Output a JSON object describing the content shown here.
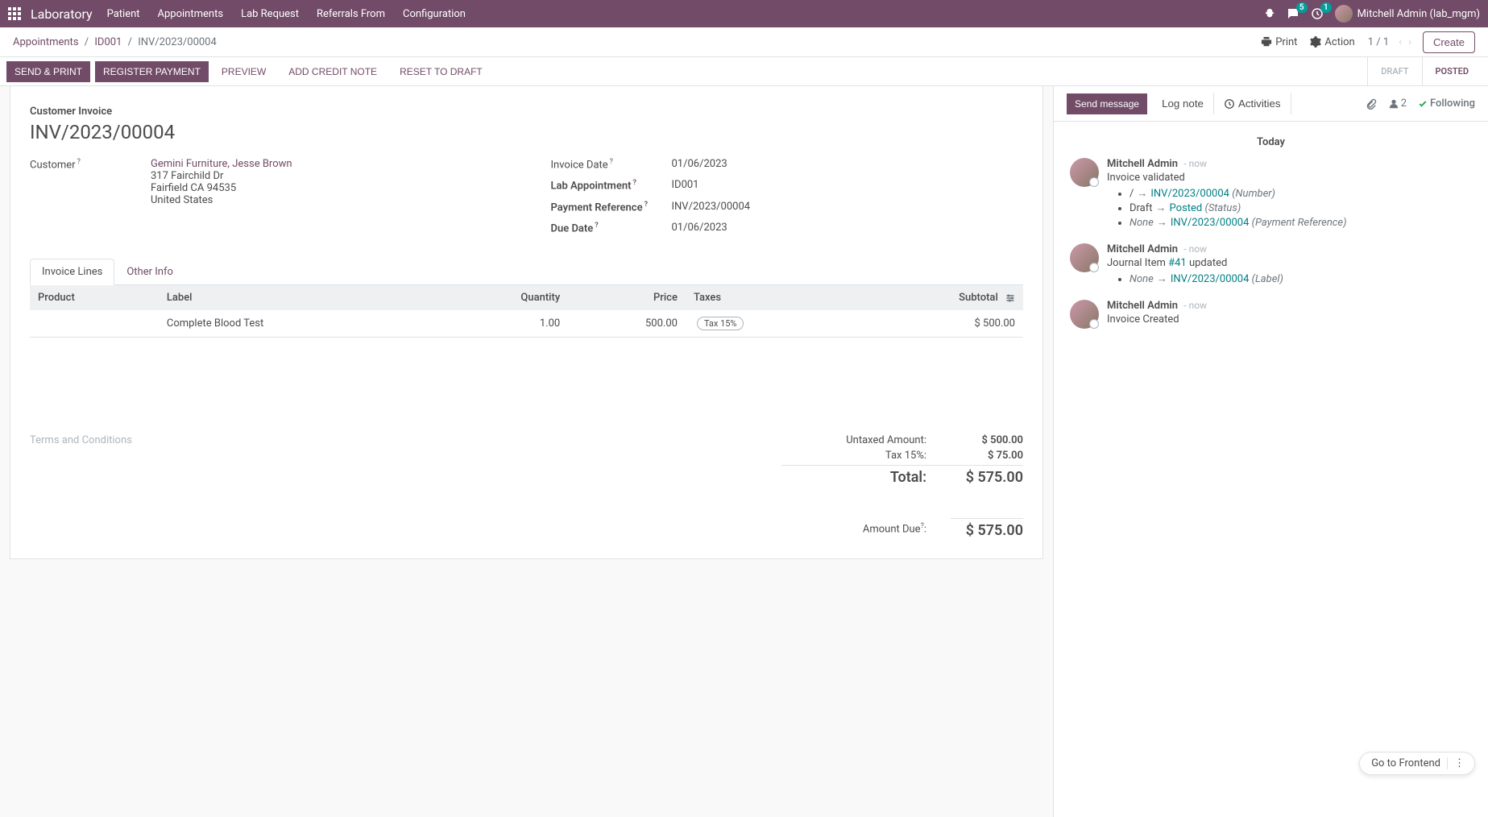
{
  "topnav": {
    "app": "Laboratory",
    "items": [
      "Patient",
      "Appointments",
      "Lab Request",
      "Referrals From",
      "Configuration"
    ],
    "msg_badge": "5",
    "clock_badge": "1",
    "user": "Mitchell Admin (lab_mgm)"
  },
  "breadcrumb": {
    "items": [
      "Appointments",
      "ID001"
    ],
    "current": "INV/2023/00004"
  },
  "controlbar": {
    "print": "Print",
    "action": "Action",
    "pager": "1 / 1",
    "create": "Create"
  },
  "statusbar": {
    "buttons": {
      "send_print": "SEND & PRINT",
      "register_payment": "REGISTER PAYMENT",
      "preview": "PREVIEW",
      "add_credit_note": "ADD CREDIT NOTE",
      "reset_draft": "RESET TO DRAFT"
    },
    "statuses": {
      "draft": "DRAFT",
      "posted": "POSTED"
    }
  },
  "invoice": {
    "subtitle": "Customer Invoice",
    "number": "INV/2023/00004",
    "customer_label": "Customer",
    "customer_name": "Gemini Furniture, Jesse Brown",
    "address1": "317 Fairchild Dr",
    "address2": "Fairfield CA 94535",
    "address3": "United States",
    "fields": {
      "invoice_date": {
        "label": "Invoice Date",
        "value": "01/06/2023"
      },
      "lab_appointment": {
        "label": "Lab Appointment",
        "value": "ID001",
        "bold": true
      },
      "payment_reference": {
        "label": "Payment Reference",
        "value": "INV/2023/00004",
        "bold": true
      },
      "due_date": {
        "label": "Due Date",
        "value": "01/06/2023",
        "bold": true
      }
    }
  },
  "tabs": {
    "lines": "Invoice Lines",
    "other": "Other Info"
  },
  "table": {
    "headers": {
      "product": "Product",
      "label": "Label",
      "quantity": "Quantity",
      "price": "Price",
      "taxes": "Taxes",
      "subtotal": "Subtotal"
    },
    "rows": [
      {
        "product": "",
        "label": "Complete Blood Test",
        "quantity": "1.00",
        "price": "500.00",
        "tax": "Tax 15%",
        "subtotal": "$ 500.00"
      }
    ]
  },
  "terms_placeholder": "Terms and Conditions",
  "totals": {
    "untaxed": {
      "label": "Untaxed Amount:",
      "value": "$ 500.00"
    },
    "tax": {
      "label": "Tax 15%:",
      "value": "$ 75.00"
    },
    "total": {
      "label": "Total:",
      "value": "$ 575.00"
    },
    "due": {
      "label": "Amount Due",
      "suffix": ":",
      "value": "$ 575.00"
    }
  },
  "chatter": {
    "send": "Send message",
    "log": "Log note",
    "activities": "Activities",
    "followers_count": "2",
    "following": "Following",
    "date": "Today",
    "messages": [
      {
        "author": "Mitchell Admin",
        "time": "- now",
        "text": "Invoice validated",
        "changes": [
          {
            "old": "/",
            "new": "INV/2023/00004",
            "field": "(Number)"
          },
          {
            "old": "Draft",
            "new": "Posted",
            "field": "(Status)"
          },
          {
            "old": "None",
            "new": "INV/2023/00004",
            "field": "(Payment Reference)"
          }
        ]
      },
      {
        "author": "Mitchell Admin",
        "time": "- now",
        "text_parts": {
          "pre": "Journal Item ",
          "link": "#41",
          "post": " updated"
        },
        "changes": [
          {
            "old": "None",
            "new": "INV/2023/00004",
            "field": "(Label)"
          }
        ]
      },
      {
        "author": "Mitchell Admin",
        "time": "- now",
        "text": "Invoice Created"
      }
    ]
  },
  "goto_frontend": "Go to Frontend"
}
